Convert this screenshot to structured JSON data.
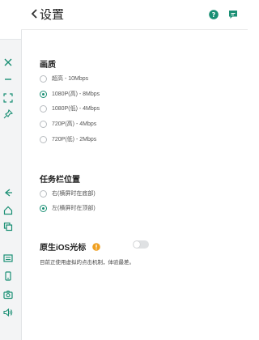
{
  "header": {
    "title": "设置"
  },
  "quality": {
    "title": "画质",
    "options": [
      {
        "label": "超高 - 10Mbps",
        "selected": false
      },
      {
        "label": "1080P(高) - 8Mbps",
        "selected": true
      },
      {
        "label": "1080P(低) - 4Mbps",
        "selected": false
      },
      {
        "label": "720P(高)   - 4Mbps",
        "selected": false
      },
      {
        "label": "720P(低)   - 2Mbps",
        "selected": false
      }
    ]
  },
  "taskbar": {
    "title": "任务栏位置",
    "options": [
      {
        "label": "右(横屏时在底部)",
        "selected": false
      },
      {
        "label": "左(横屏时在顶部)",
        "selected": true
      }
    ]
  },
  "ios_cursor": {
    "title": "原生iOS光标",
    "enabled": false,
    "note": "目前正使用虚拟的点击机制，体验最差。"
  },
  "colors": {
    "accent": "#1a8f74",
    "warning": "#f0a020",
    "toggle_off": "#dfe1e3"
  }
}
